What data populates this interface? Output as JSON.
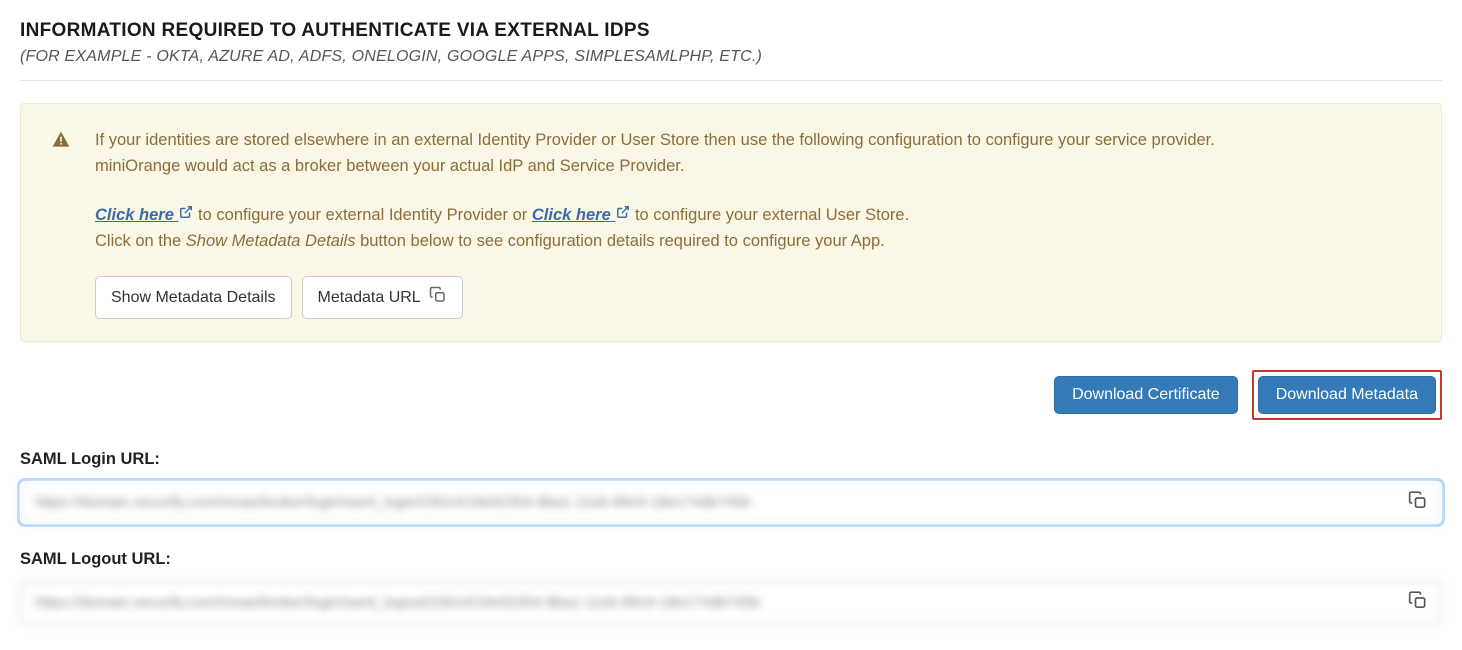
{
  "section": {
    "title": "INFORMATION REQUIRED TO AUTHENTICATE VIA EXTERNAL IDPS",
    "subtitle": "(FOR EXAMPLE - OKTA, AZURE AD, ADFS, ONELOGIN, GOOGLE APPS, SIMPLESAMLPHP, ETC.)"
  },
  "alert": {
    "intro1": "If your identities are stored elsewhere in an external Identity Provider or User Store then use the following configuration to configure your service provider.",
    "intro2": "miniOrange would act as a broker between your actual IdP and Service Provider.",
    "click_here": "Click here",
    "cfg_idp_text": " to configure your external Identity Provider or ",
    "cfg_userstore_text": " to configure your external User Store.",
    "meta_prefix": "Click on the ",
    "meta_button_name": "Show Metadata Details",
    "meta_suffix": " button below to see configuration details required to configure your App."
  },
  "buttons": {
    "show_metadata": "Show Metadata Details",
    "metadata_url": "Metadata URL",
    "download_cert": "Download Certificate",
    "download_meta": "Download Metadata"
  },
  "fields": {
    "saml_login_label": "SAML Login URL:",
    "saml_login_value": "https://domain.xecurify.com/moas/broker/login/saml_login/23014/19e92354-8ba1-11eb-89c9-18e174db745b",
    "saml_logout_label": "SAML Logout URL:",
    "saml_logout_value": "https://domain.xecurify.com/moas/broker/login/saml_logout/23014/19e92354-8ba1-11eb-89c9-18e174db745b"
  }
}
